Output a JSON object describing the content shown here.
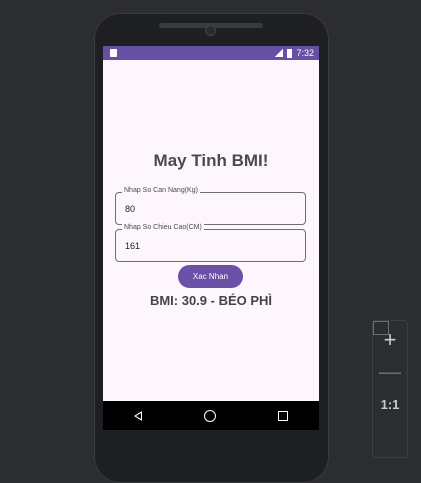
{
  "status_bar": {
    "time": "7:32"
  },
  "app": {
    "title": "May Tinh BMI!",
    "weight_field": {
      "label": "Nhap So Can Nang(Kg)",
      "value": "80"
    },
    "height_field": {
      "label": "Nhap So Chieu Cao(CM)",
      "value": "161"
    },
    "confirm_button": "Xac Nhan",
    "result": "BMI: 30.9 - BÉO PHÌ"
  },
  "emulator_controls": {
    "zoom_in": "+",
    "zoom_out": "—",
    "ratio": "1:1"
  },
  "colors": {
    "primary": "#6a50a7",
    "status_bar": "#6650a4",
    "background": "#fdf7fd"
  }
}
